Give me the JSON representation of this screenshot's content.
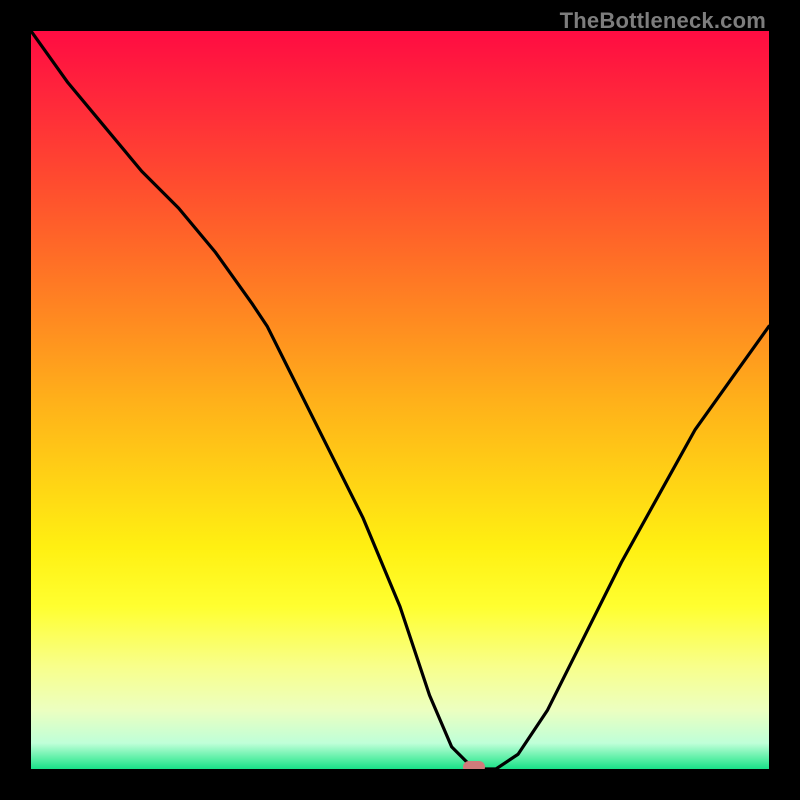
{
  "watermark": "TheBottleneck.com",
  "marker": {
    "x_pct": 60,
    "y_pct": 100,
    "color": "#d07b7b"
  },
  "gradient": {
    "stops": [
      {
        "offset": 0.0,
        "color": "#ff0c42"
      },
      {
        "offset": 0.1,
        "color": "#ff2a3a"
      },
      {
        "offset": 0.2,
        "color": "#ff4a2f"
      },
      {
        "offset": 0.3,
        "color": "#ff6b27"
      },
      {
        "offset": 0.4,
        "color": "#ff8d20"
      },
      {
        "offset": 0.5,
        "color": "#ffb01a"
      },
      {
        "offset": 0.6,
        "color": "#ffd015"
      },
      {
        "offset": 0.7,
        "color": "#fff012"
      },
      {
        "offset": 0.78,
        "color": "#ffff30"
      },
      {
        "offset": 0.86,
        "color": "#f8ff8a"
      },
      {
        "offset": 0.92,
        "color": "#ecffc0"
      },
      {
        "offset": 0.965,
        "color": "#bfffd8"
      },
      {
        "offset": 0.985,
        "color": "#5ff0a8"
      },
      {
        "offset": 1.0,
        "color": "#18e088"
      }
    ]
  },
  "chart_data": {
    "type": "line",
    "title": "",
    "xlabel": "",
    "ylabel": "",
    "xlim": [
      0,
      100
    ],
    "ylim": [
      0,
      100
    ],
    "series": [
      {
        "name": "bottleneck-curve",
        "x": [
          0,
          5,
          10,
          15,
          20,
          25,
          30,
          32,
          35,
          40,
          45,
          50,
          54,
          57,
          60,
          63,
          66,
          70,
          75,
          80,
          85,
          90,
          95,
          100
        ],
        "y": [
          100,
          93,
          87,
          81,
          76,
          70,
          63,
          60,
          54,
          44,
          34,
          22,
          10,
          3,
          0,
          0,
          2,
          8,
          18,
          28,
          37,
          46,
          53,
          60
        ]
      }
    ],
    "annotations": [
      {
        "type": "marker",
        "x": 60,
        "y": 0,
        "label": "optimal-point"
      }
    ]
  }
}
